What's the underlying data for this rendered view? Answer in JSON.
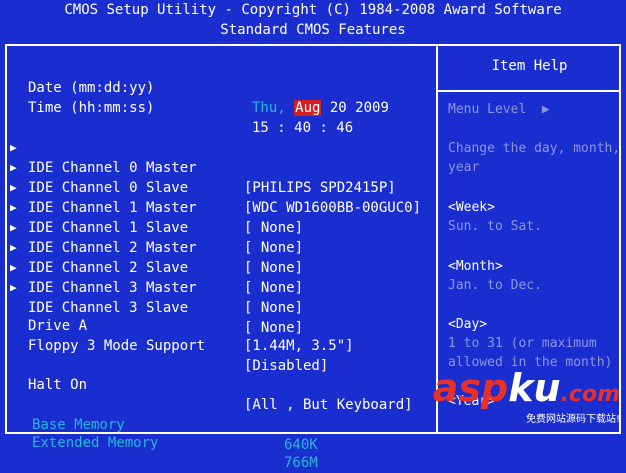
{
  "header": {
    "line1": "CMOS Setup Utility - Copyright (C) 1984-2008 Award Software",
    "line2": "Standard CMOS Features"
  },
  "date": {
    "label": "Date (mm:dd:yy)",
    "day": "Thu,",
    "month": "Aug",
    "rest": " 20 2009"
  },
  "time": {
    "label": "Time (hh:mm:ss)",
    "value": "15 : 40 : 46"
  },
  "ide": [
    {
      "label": "IDE Channel 0 Master",
      "value": "[PHILIPS SPD2415P]"
    },
    {
      "label": "IDE Channel 0 Slave",
      "value": "[WDC WD1600BB-00GUC0]"
    },
    {
      "label": "IDE Channel 1 Master",
      "value": "[ None]"
    },
    {
      "label": "IDE Channel 1 Slave",
      "value": "[ None]"
    },
    {
      "label": "IDE Channel 2 Master",
      "value": "[ None]"
    },
    {
      "label": "IDE Channel 2 Slave",
      "value": "[ None]"
    },
    {
      "label": "IDE Channel 3 Master",
      "value": "[ None]"
    },
    {
      "label": "IDE Channel 3 Slave",
      "value": "[ None]"
    }
  ],
  "arrow_glyph": "▶",
  "drive_a": {
    "label": "Drive A",
    "value": "[1.44M, 3.5\"]"
  },
  "floppy": {
    "label": "Floppy 3 Mode Support",
    "value": "[Disabled]"
  },
  "halt": {
    "label": "Halt On",
    "value": "[All , But Keyboard]"
  },
  "base_memory": {
    "label": "Base Memory",
    "value": "640K"
  },
  "extended_memory": {
    "label": "Extended Memory",
    "value": "766M"
  },
  "help": {
    "title": "Item Help",
    "menu_level": "Menu Level  ▶",
    "desc": "Change the day, month, year",
    "week_title": "<Week>",
    "week_text": "Sun. to Sat.",
    "month_title": "<Month>",
    "month_text": "Jan. to Dec.",
    "day_title": "<Day>",
    "day_text": "1 to 31 (or maximum allowed in the month)",
    "year_title": "<Year>"
  },
  "watermark": {
    "part1": "asp",
    "part2": "ku",
    "part3": ".com",
    "subtitle": "免费网站源码下载站!"
  },
  "colors": {
    "background": "#1a2ed0",
    "highlight": "#d02020",
    "cyan": "#22b8d8"
  }
}
